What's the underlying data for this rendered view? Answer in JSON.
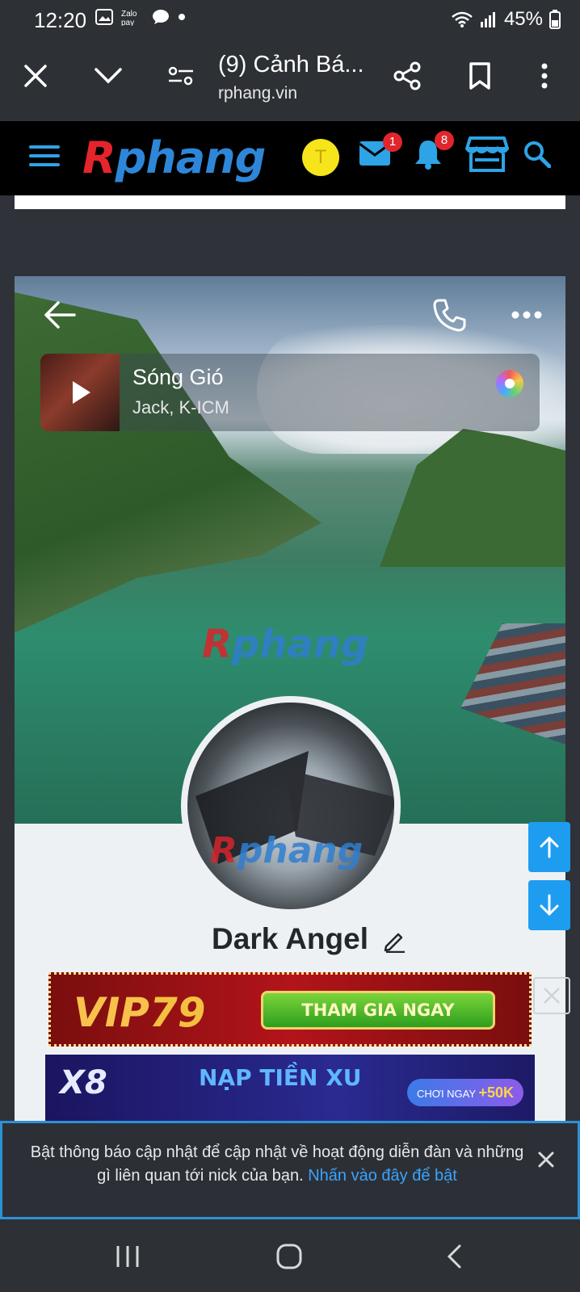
{
  "status_bar": {
    "time": "12:20",
    "battery": "45%",
    "icons": [
      "gallery-icon",
      "zalopay-icon",
      "chat-icon",
      "dot-icon",
      "wifi-icon",
      "signal-icon",
      "battery-icon"
    ]
  },
  "browser": {
    "title": "(9) Cảnh Bá...",
    "url": "rphang.vin",
    "buttons": [
      "close",
      "collapse",
      "page-settings",
      "share",
      "bookmark",
      "more"
    ]
  },
  "site_header": {
    "logo_text_r": "R",
    "logo_text_rest": "phang",
    "avatar_letter": "T",
    "avatar_color": "#f6e51b",
    "messages_badge": "1",
    "notifications_badge": "8",
    "accent_color": "#2ea3e6"
  },
  "profile": {
    "music": {
      "title": "Sóng Gió",
      "artist": "Jack, K-ICM"
    },
    "watermark_r": "R",
    "watermark_rest": "phang",
    "name": "Dark Angel"
  },
  "ads": {
    "ad1_brand": "VIP79",
    "ad1_brand_a": "VIP",
    "ad1_brand_b": "79",
    "ad1_cta": "THAM GIA NGAY",
    "ad2_brand": "X8",
    "ad2_text": "NẠP TIỀN XU",
    "ad2_pill_a": "CHƠI NGAY",
    "ad2_pill_b": "+50K"
  },
  "notice": {
    "text": "Bật thông báo cập nhật để cập nhật về hoạt động diễn đàn và những gì liên quan tới nick của bạn.",
    "link": "Nhấn vào đây để bật"
  }
}
